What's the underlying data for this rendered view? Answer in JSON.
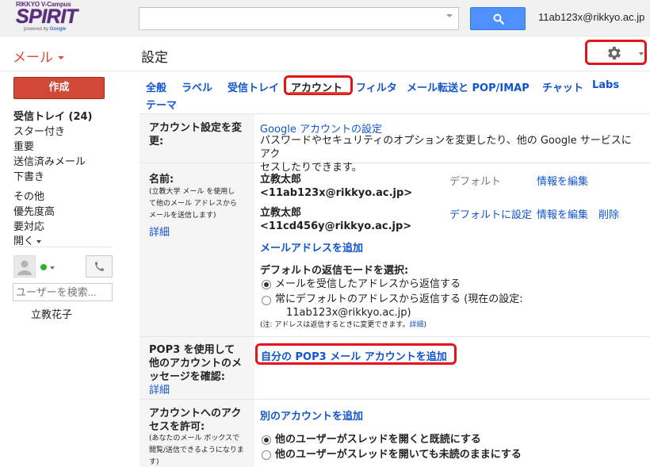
{
  "header": {
    "logo_top": "RIKKYO V-Campus",
    "logo_main": "SPIRIT",
    "logo_powered": "powered by",
    "logo_google": "Google",
    "search_placeholder": "",
    "user_email": "11ab123x@rikkyo.ac.jp"
  },
  "toolbar": {
    "mail_label": "メール",
    "page_title": "設定"
  },
  "sidebar": {
    "compose_label": "作成",
    "items": [
      {
        "label": "受信トレイ (24)",
        "bold": true
      },
      {
        "label": "スター付き"
      },
      {
        "label": "重要"
      },
      {
        "label": "送信済みメール"
      },
      {
        "label": "下書き"
      },
      {
        "label": "その他"
      },
      {
        "label": "優先度高"
      },
      {
        "label": "要対応"
      },
      {
        "label": "開く"
      }
    ],
    "people_search_placeholder": "ユーザーを検索...",
    "contact": "立教花子"
  },
  "tabs": [
    {
      "label": "全般"
    },
    {
      "label": "ラベル"
    },
    {
      "label": "受信トレイ"
    },
    {
      "label": "アカウント",
      "active": true
    },
    {
      "label": "フィルタ"
    },
    {
      "label": "メール転送と POP/IMAP"
    },
    {
      "label": "チャット"
    },
    {
      "label": "Labs"
    },
    {
      "label": "テーマ"
    }
  ],
  "account_settings": {
    "label_line1": "アカウント設定を変",
    "label_line2": "更:",
    "google_link": "Google アカウントの設定",
    "desc_line1": "パスワードやセキュリティのオプションを変更したり、他の Google サービスにアク",
    "desc_line2": "セスしたりできます。"
  },
  "name_section": {
    "label": "名前:",
    "sub_line1": "(立教大学 メール を使用し",
    "sub_line2": "て他のメール アドレスから",
    "sub_line3": "メールを送信します)",
    "detail": "詳細",
    "entries": [
      {
        "name": "立教太郎",
        "address": "<11ab123x@rikkyo.ac.jp>",
        "default_label": "デフォルト",
        "edit": "情報を編集"
      },
      {
        "name": "立教太郎",
        "address": "<11cd456y@rikkyo.ac.jp>",
        "make_default": "デフォルトに設定",
        "edit": "情報を編集",
        "delete": "削除"
      }
    ],
    "add_address": "メールアドレスを追加",
    "reply_mode_title": "デフォルトの返信モードを選択:",
    "reply_option1": "メールを受信したアドレスから返信する",
    "reply_option2_line1": "常にデフォルトのアドレスから返信する (現在の設定:",
    "reply_option2_line2": "11ab123x@rikkyo.ac.jp)",
    "note": "(注: アドレスは返信するときに変更できます。",
    "note_link": "詳細",
    "note_end": ")"
  },
  "pop3_section": {
    "label_line1": "POP3 を使用して",
    "label_line2": "他のアカウントのメ",
    "label_line3": "ッセージを確認:",
    "detail": "詳細",
    "add_link": "自分の POP3 メール アカウントを追加"
  },
  "grant_access_section": {
    "label_line1": "アカウントへのアク",
    "label_line2": "セスを許可:",
    "sub_line1": "(あなたのメール ボックスで",
    "sub_line2": "閲覧/送信できるようになりま",
    "sub_line3": "す)",
    "add_link": "別のアカウントを追加",
    "option1": "他のユーザーがスレッドを開くと既読にする",
    "option2": "他のユーザーがスレッドを開いても未読のままにする"
  },
  "colors": {
    "link": "#1155cc",
    "accent_red": "#dd4b39",
    "highlight_red": "#e3141c",
    "search_blue": "#4d90fe",
    "brand_purple": "#5b2d7e"
  }
}
